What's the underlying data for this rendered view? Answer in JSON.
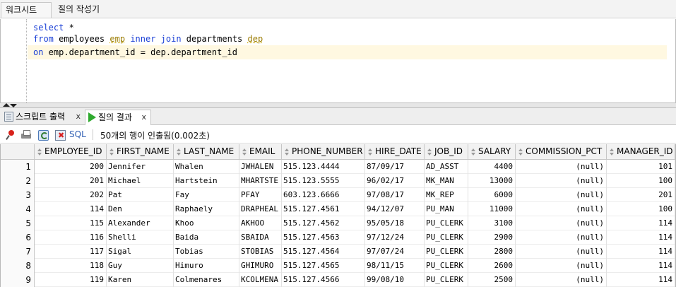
{
  "top_tabs": [
    "워크시트",
    "질의 작성기"
  ],
  "editor": {
    "lines": [
      [
        {
          "t": "select",
          "c": "kw"
        },
        {
          "t": " *",
          "c": "plain"
        }
      ],
      [
        {
          "t": "from",
          "c": "kw"
        },
        {
          "t": " employees ",
          "c": "plain"
        },
        {
          "t": "emp",
          "c": "alias"
        },
        {
          "t": " ",
          "c": "plain"
        },
        {
          "t": "inner",
          "c": "kw"
        },
        {
          "t": " ",
          "c": "plain"
        },
        {
          "t": "join",
          "c": "kw"
        },
        {
          "t": " departments ",
          "c": "plain"
        },
        {
          "t": "dep",
          "c": "alias"
        }
      ],
      [
        {
          "t": "on",
          "c": "kw"
        },
        {
          "t": " emp.department_id = dep.department_id",
          "c": "plain"
        }
      ]
    ]
  },
  "result_tabs": {
    "script_output": "스크립트 출력",
    "query_result": "질의 결과",
    "close": "x"
  },
  "toolbar": {
    "sql_label": "SQL",
    "status": "50개의 행이 인출됨(0.002초)"
  },
  "grid": {
    "columns": [
      "EMPLOYEE_ID",
      "FIRST_NAME",
      "LAST_NAME",
      "EMAIL",
      "PHONE_NUMBER",
      "HIRE_DATE",
      "JOB_ID",
      "SALARY",
      "COMMISSION_PCT",
      "MANAGER_ID"
    ],
    "rows": [
      [
        "1",
        "200",
        "Jennifer",
        "Whalen",
        "JWHALEN",
        "515.123.4444",
        "87/09/17",
        "AD_ASST",
        "4400",
        "(null)",
        "101"
      ],
      [
        "2",
        "201",
        "Michael",
        "Hartstein",
        "MHARTSTE",
        "515.123.5555",
        "96/02/17",
        "MK_MAN",
        "13000",
        "(null)",
        "100"
      ],
      [
        "3",
        "202",
        "Pat",
        "Fay",
        "PFAY",
        "603.123.6666",
        "97/08/17",
        "MK_REP",
        "6000",
        "(null)",
        "201"
      ],
      [
        "4",
        "114",
        "Den",
        "Raphaely",
        "DRAPHEAL",
        "515.127.4561",
        "94/12/07",
        "PU_MAN",
        "11000",
        "(null)",
        "100"
      ],
      [
        "5",
        "115",
        "Alexander",
        "Khoo",
        "AKHOO",
        "515.127.4562",
        "95/05/18",
        "PU_CLERK",
        "3100",
        "(null)",
        "114"
      ],
      [
        "6",
        "116",
        "Shelli",
        "Baida",
        "SBAIDA",
        "515.127.4563",
        "97/12/24",
        "PU_CLERK",
        "2900",
        "(null)",
        "114"
      ],
      [
        "7",
        "117",
        "Sigal",
        "Tobias",
        "STOBIAS",
        "515.127.4564",
        "97/07/24",
        "PU_CLERK",
        "2800",
        "(null)",
        "114"
      ],
      [
        "8",
        "118",
        "Guy",
        "Himuro",
        "GHIMURO",
        "515.127.4565",
        "98/11/15",
        "PU_CLERK",
        "2600",
        "(null)",
        "114"
      ],
      [
        "9",
        "119",
        "Karen",
        "Colmenares",
        "KCOLMENA",
        "515.127.4566",
        "99/08/10",
        "PU_CLERK",
        "2500",
        "(null)",
        "114"
      ]
    ]
  },
  "icons": {
    "pin": "pin-icon",
    "print": "print-icon",
    "refresh": "refresh-icon",
    "clear": "clear-icon",
    "script": "script-output-icon",
    "run": "run-icon"
  }
}
